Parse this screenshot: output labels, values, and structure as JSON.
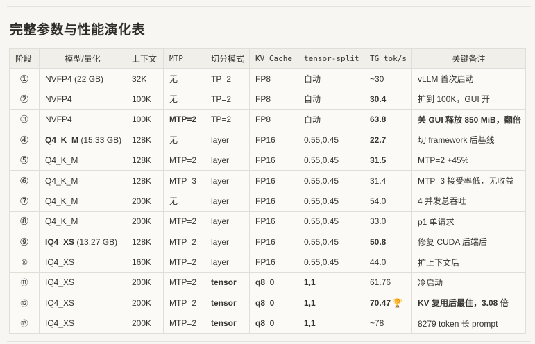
{
  "title": "完整参数与性能演化表",
  "headers": [
    "阶段",
    "模型/量化",
    "上下文",
    "MTP",
    "切分模式",
    "KV Cache",
    "tensor-split",
    "TG tok/s",
    "关键备注"
  ],
  "rows": [
    {
      "stage": "①",
      "model": "NVFP4",
      "model_note": "(22 GB)",
      "ctx": "32K",
      "mtp": "无",
      "split": "TP=2",
      "kv": "FP8",
      "ts": "自动",
      "tg": "~30",
      "note": "vLLM 首次启动"
    },
    {
      "stage": "②",
      "model": "NVFP4",
      "model_note": "",
      "ctx": "100K",
      "mtp": "无",
      "split": "TP=2",
      "kv": "FP8",
      "ts": "自动",
      "tg": "30.4",
      "note": "扩到 100K，GUI 开"
    },
    {
      "stage": "③",
      "model": "NVFP4",
      "model_note": "",
      "ctx": "100K",
      "mtp": "MTP=2",
      "split": "TP=2",
      "kv": "FP8",
      "ts": "自动",
      "tg": "63.8",
      "note": "关 GUI 释放 850 MiB，翻倍"
    },
    {
      "stage": "④",
      "model": "Q4_K_M",
      "model_note": "(15.33 GB)",
      "ctx": "128K",
      "mtp": "无",
      "split": "layer",
      "kv": "FP16",
      "ts": "0.55,0.45",
      "tg": "22.7",
      "note": "切 framework 后基线"
    },
    {
      "stage": "⑤",
      "model": "Q4_K_M",
      "model_note": "",
      "ctx": "128K",
      "mtp": "MTP=2",
      "split": "layer",
      "kv": "FP16",
      "ts": "0.55,0.45",
      "tg": "31.5",
      "note": "MTP=2 +45%"
    },
    {
      "stage": "⑥",
      "model": "Q4_K_M",
      "model_note": "",
      "ctx": "128K",
      "mtp": "MTP=3",
      "split": "layer",
      "kv": "FP16",
      "ts": "0.55,0.45",
      "tg": "31.4",
      "note": "MTP=3 接受率低，无收益"
    },
    {
      "stage": "⑦",
      "model": "Q4_K_M",
      "model_note": "",
      "ctx": "200K",
      "mtp": "无",
      "split": "layer",
      "kv": "FP16",
      "ts": "0.55,0.45",
      "tg": "54.0",
      "note": "4 并发总吞吐"
    },
    {
      "stage": "⑧",
      "model": "Q4_K_M",
      "model_note": "",
      "ctx": "200K",
      "mtp": "MTP=2",
      "split": "layer",
      "kv": "FP16",
      "ts": "0.55,0.45",
      "tg": "33.0",
      "note": "p1 单请求"
    },
    {
      "stage": "⑨",
      "model": "IQ4_XS",
      "model_note": "(13.27 GB)",
      "ctx": "128K",
      "mtp": "MTP=2",
      "split": "layer",
      "kv": "FP16",
      "ts": "0.55,0.45",
      "tg": "50.8",
      "note": "修复 CUDA 后端后"
    },
    {
      "stage": "⑩",
      "model": "IQ4_XS",
      "model_note": "",
      "ctx": "160K",
      "mtp": "MTP=2",
      "split": "layer",
      "kv": "FP16",
      "ts": "0.55,0.45",
      "tg": "44.0",
      "note": "扩上下文后"
    },
    {
      "stage": "⑪",
      "model": "IQ4_XS",
      "model_note": "",
      "ctx": "200K",
      "mtp": "MTP=2",
      "split": "tensor",
      "kv": "q8_0",
      "ts": "1,1",
      "tg": "61.76",
      "note": "冷启动"
    },
    {
      "stage": "⑫",
      "model": "IQ4_XS",
      "model_note": "",
      "ctx": "200K",
      "mtp": "MTP=2",
      "split": "tensor",
      "kv": "q8_0",
      "ts": "1,1",
      "tg": "70.47",
      "note": "KV 复用后最佳，3.08 倍"
    },
    {
      "stage": "⑬",
      "model": "IQ4_XS",
      "model_note": "",
      "ctx": "200K",
      "mtp": "MTP=2",
      "split": "tensor",
      "kv": "q8_0",
      "ts": "1,1",
      "tg": "~78",
      "note": "8279 token 长 prompt"
    }
  ]
}
